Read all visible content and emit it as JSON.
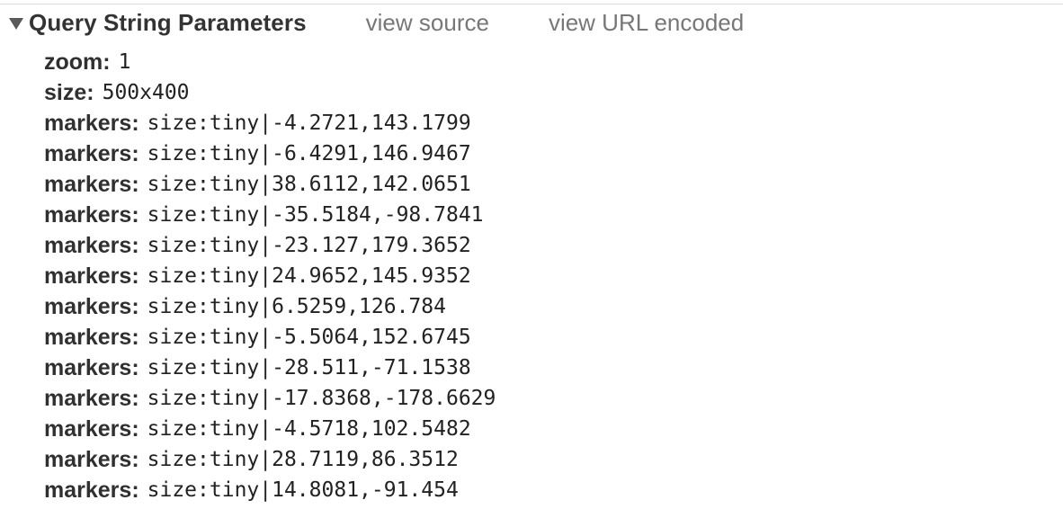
{
  "section": {
    "title": "Query String Parameters",
    "view_source_label": "view source",
    "view_url_encoded_label": "view URL encoded",
    "expanded": true
  },
  "params": [
    {
      "name": "zoom",
      "value": "1"
    },
    {
      "name": "size",
      "value": "500x400"
    },
    {
      "name": "markers",
      "value": "size:tiny|-4.2721,143.1799"
    },
    {
      "name": "markers",
      "value": "size:tiny|-6.4291,146.9467"
    },
    {
      "name": "markers",
      "value": "size:tiny|38.6112,142.0651"
    },
    {
      "name": "markers",
      "value": "size:tiny|-35.5184,-98.7841"
    },
    {
      "name": "markers",
      "value": "size:tiny|-23.127,179.3652"
    },
    {
      "name": "markers",
      "value": "size:tiny|24.9652,145.9352"
    },
    {
      "name": "markers",
      "value": "size:tiny|6.5259,126.784"
    },
    {
      "name": "markers",
      "value": "size:tiny|-5.5064,152.6745"
    },
    {
      "name": "markers",
      "value": "size:tiny|-28.511,-71.1538"
    },
    {
      "name": "markers",
      "value": "size:tiny|-17.8368,-178.6629"
    },
    {
      "name": "markers",
      "value": "size:tiny|-4.5718,102.5482"
    },
    {
      "name": "markers",
      "value": "size:tiny|28.7119,86.3512"
    },
    {
      "name": "markers",
      "value": "size:tiny|14.8081,-91.454"
    }
  ],
  "colors": {
    "title": "#333333",
    "link": "#777777",
    "param_name": "#303030",
    "param_value": "#222222",
    "divider": "#dcdcdc"
  }
}
